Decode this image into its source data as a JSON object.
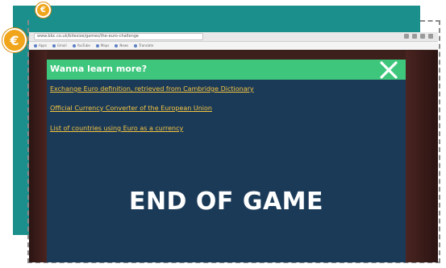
{
  "browser": {
    "url": "www.bbc.co.uk/bitesize/games/the-euro-challenge",
    "bookmarks": [
      "Apps",
      "Gmail",
      "YouTube",
      "Maps",
      "News",
      "Translate"
    ]
  },
  "modal": {
    "title": "Wanna learn more?",
    "links": [
      "Exchange Euro definition, retrieved from Cambridge Dictionary",
      "Official Currency Converter of the European Union",
      "List of countries using Euro as a currency"
    ],
    "end_message": "END OF GAME"
  },
  "icons": {
    "coin_small": "euro-coin-icon",
    "coin_large": "euro-coin-icon",
    "close": "close-icon"
  },
  "colors": {
    "teal_panel": "#1a8f8c",
    "modal_header": "#3ec77c",
    "modal_body": "#1b3a57",
    "link": "#f5c542",
    "coin": "#f0a51b"
  }
}
